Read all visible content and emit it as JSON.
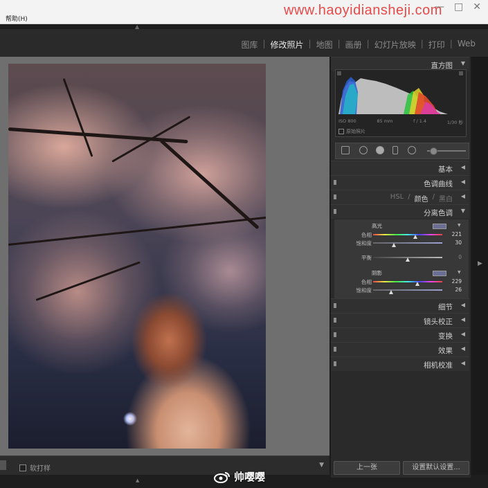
{
  "menubar": {
    "help": "帮助(H)",
    "watermark": "www.haoyidiansheji.com",
    "win_buttons": [
      "—",
      "□",
      "✕"
    ]
  },
  "modules": [
    {
      "label": "图库",
      "active": false
    },
    {
      "label": "修改照片",
      "active": true
    },
    {
      "label": "地图",
      "active": false
    },
    {
      "label": "画册",
      "active": false
    },
    {
      "label": "幻灯片放映",
      "active": false
    },
    {
      "label": "打印",
      "active": false
    },
    {
      "label": "Web",
      "active": false
    }
  ],
  "histogram": {
    "title": "直方图",
    "iso": "ISO 800",
    "focal": "85 mm",
    "aperture": "f / 1.4",
    "shutter": "1/30 秒",
    "original_label": "原始照片"
  },
  "panels": {
    "basic": "基本",
    "tone_curve": "色调曲线",
    "hsl": {
      "items": [
        "HSL",
        "颜色",
        "黑白"
      ],
      "separator": "/",
      "active_index": 1
    },
    "split_toning": "分离色调",
    "detail": "细节",
    "lens": "镜头校正",
    "transform": "变换",
    "effects": "效果",
    "camera": "相机校准"
  },
  "split_toning": {
    "highlights": {
      "title": "高光",
      "hue_label": "色相",
      "hue": 221,
      "sat_label": "饱和度",
      "sat": 30,
      "swatch": "#6c6e94"
    },
    "balance": {
      "label": "平衡",
      "value": 0
    },
    "shadows": {
      "title": "阴影",
      "hue_label": "色相",
      "hue": 229,
      "sat_label": "饱和度",
      "sat": 26,
      "swatch": "#6a6f96"
    }
  },
  "footer": {
    "prev": "上一张",
    "reset": "设置默认设置..."
  },
  "filmstrip": {
    "soft_proof": "软打样"
  },
  "weibo": {
    "name": "帅嘤嘤"
  },
  "colors": {
    "panel_bg": "#2a2a2a",
    "active_text": "#e8e8e8",
    "watermark": "#e84a4a"
  }
}
